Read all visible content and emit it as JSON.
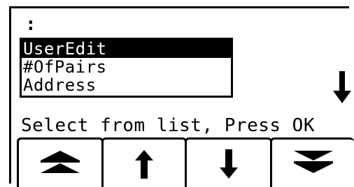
{
  "screen": {
    "header": ":",
    "list": {
      "items": [
        {
          "label": "UserEdit",
          "selected": true
        },
        {
          "label": "#OfPairs",
          "selected": false
        },
        {
          "label": "Address",
          "selected": false
        }
      ]
    },
    "side_indicator_icon": "arrow-down-icon",
    "prompt": "Select from list, Press OK"
  },
  "softkeys": [
    {
      "icon": "double-arrow-up-icon",
      "action": "page-up"
    },
    {
      "icon": "arrow-up-icon",
      "action": "up"
    },
    {
      "icon": "arrow-down-icon",
      "action": "down"
    },
    {
      "icon": "double-arrow-down-icon",
      "action": "page-down"
    }
  ],
  "colors": {
    "foreground": "#000000",
    "background": "#ffffff"
  }
}
